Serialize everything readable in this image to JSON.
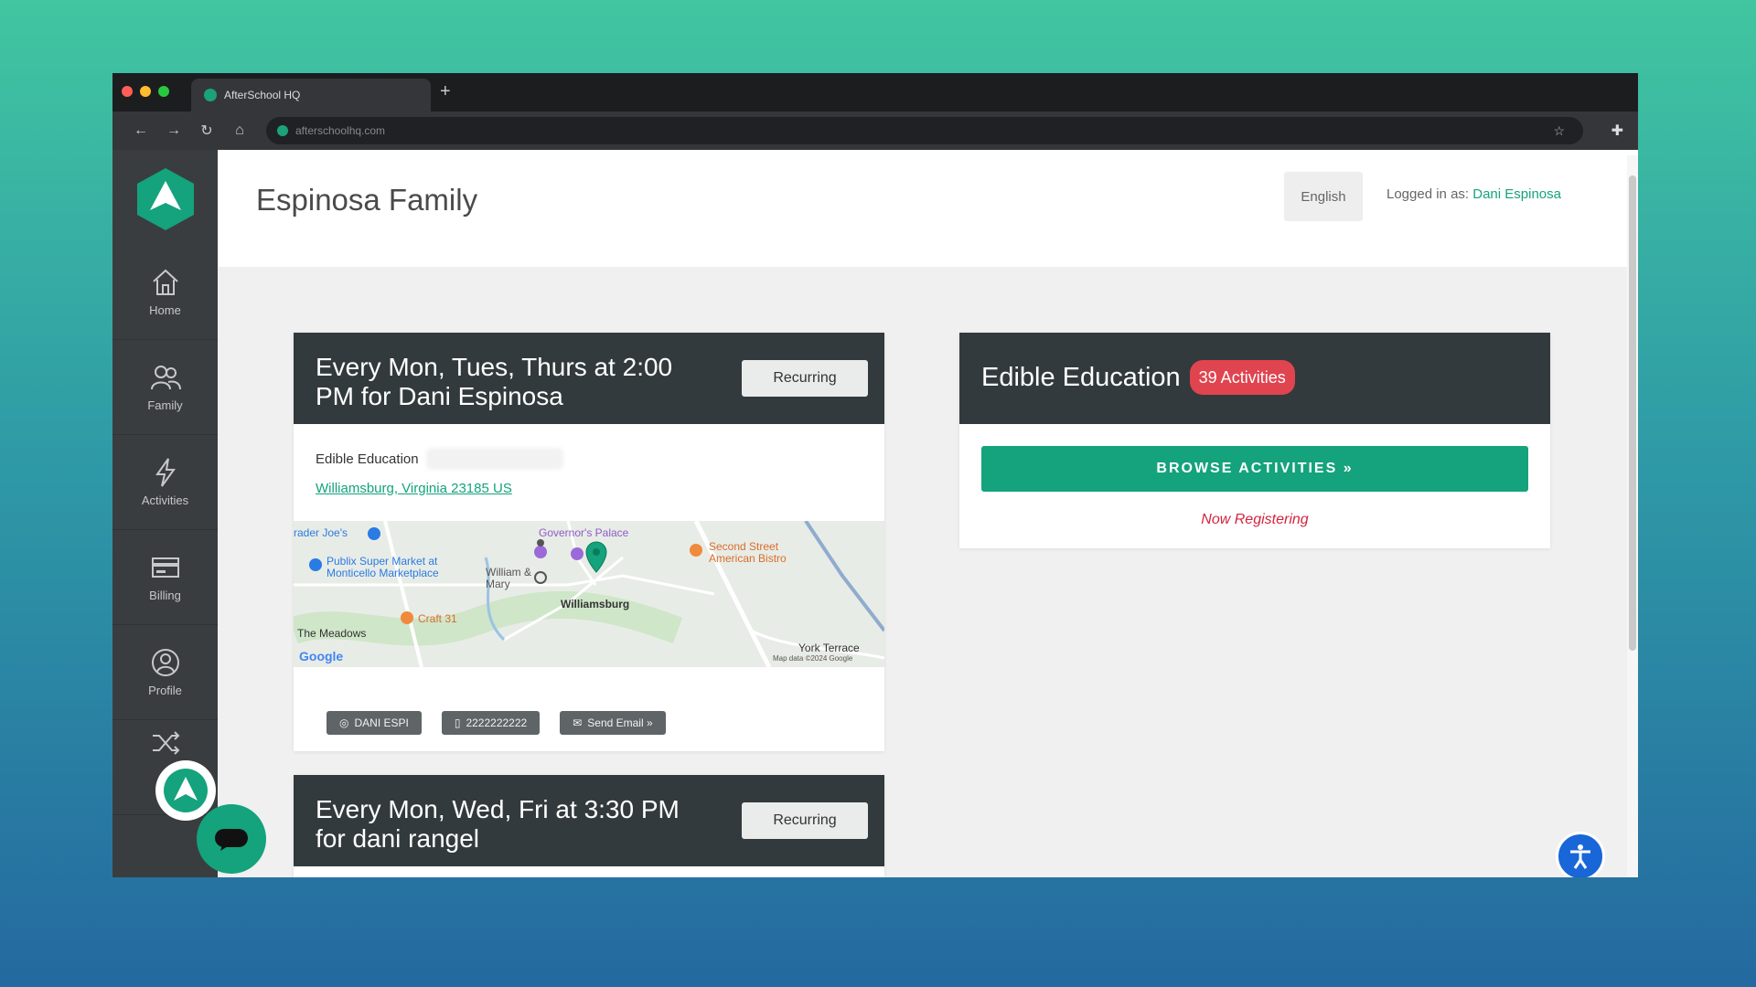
{
  "browser": {
    "tab_title": "AfterSchool HQ",
    "new_tab": "+",
    "url": "afterschoolhq.com",
    "traffic_colors": [
      "#ff5f57",
      "#febc2e",
      "#28c840"
    ]
  },
  "sidebar": {
    "items": [
      {
        "label": "Home",
        "icon": "home-icon"
      },
      {
        "label": "Family",
        "icon": "family-icon"
      },
      {
        "label": "Activities",
        "icon": "lightning-icon"
      },
      {
        "label": "Billing",
        "icon": "billing-icon"
      },
      {
        "label": "Profile",
        "icon": "profile-icon"
      }
    ]
  },
  "header": {
    "title": "Espinosa Family",
    "language": "English",
    "logged_in_prefix": "Logged in as:",
    "logged_in_user": "Dani Espinosa"
  },
  "enrollments": [
    {
      "schedule": "Every Mon, Tues, Thurs at 2:00 PM for Dani Espinosa",
      "badge": "Recurring",
      "org": "Edible Education",
      "address": "Williamsburg, Virginia 23185 US",
      "map": {
        "labels": [
          "Governor's Palace",
          "Publix Super Market at Monticello Marketplace",
          "William & Mary",
          "Williamsburg",
          "Second Street American Bistro",
          "Craft 31",
          "The Meadows",
          "York Terrace",
          "Google",
          "Map data ©2024 Google",
          "rader Joe's"
        ]
      },
      "chips": [
        "DANI ESPI",
        "2222222222",
        "Send Email »"
      ]
    },
    {
      "schedule": "Every Mon, Wed, Fri at 3:30 PM for dani rangel",
      "badge": "Recurring"
    }
  ],
  "provider": {
    "name": "Edible Education",
    "count_badge": "39 Activities",
    "browse_label": "BROWSE ACTIVITIES »",
    "status": "Now Registering"
  },
  "colors": {
    "brand": "#14a37c",
    "dark_header": "#333a3d",
    "alert": "#e0444f",
    "accessibility": "#1866d8"
  }
}
